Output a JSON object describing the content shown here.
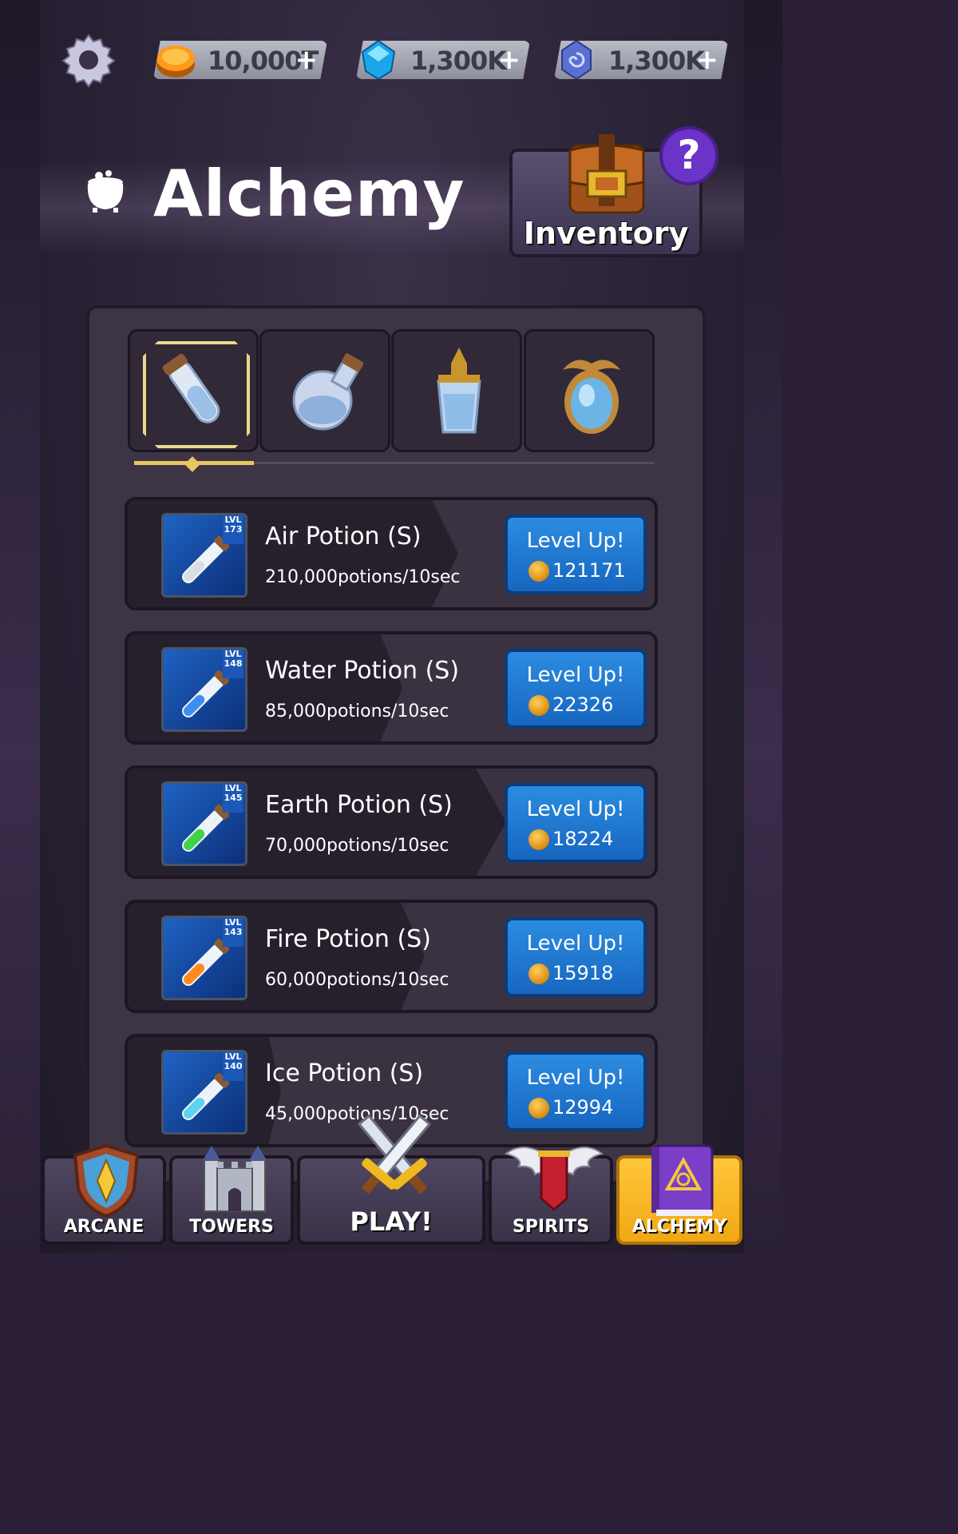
{
  "topbar": {
    "settings_icon": "gear-icon",
    "currencies": [
      {
        "name": "gold",
        "icon": "gold-coin-icon",
        "value": "10,000T",
        "plus": "+"
      },
      {
        "name": "gems",
        "icon": "blue-gem-icon",
        "value": "1,300K",
        "plus": "+"
      },
      {
        "name": "mana",
        "icon": "spiral-crystal-icon",
        "value": "1,300K",
        "plus": "+"
      }
    ]
  },
  "header": {
    "title": "Alchemy",
    "title_icon": "cauldron-icon",
    "inventory_label": "Inventory",
    "help_label": "?"
  },
  "tabs": [
    {
      "icon": "test-tube-potion-icon",
      "selected": true
    },
    {
      "icon": "round-flask-potion-icon",
      "selected": false
    },
    {
      "icon": "crystal-bottle-potion-icon",
      "selected": false
    },
    {
      "icon": "ornate-orb-potion-icon",
      "selected": false
    }
  ],
  "potions": [
    {
      "name": "Air Potion (S)",
      "rate": "210,000potions/10sec",
      "lvl_label": "LVL",
      "level": "173",
      "button": "Level Up!",
      "cost": "121171",
      "liquid": "#d8dde6"
    },
    {
      "name": "Water Potion (S)",
      "rate": "85,000potions/10sec",
      "lvl_label": "LVL",
      "level": "148",
      "button": "Level Up!",
      "cost": "22326",
      "liquid": "#3d8ff0"
    },
    {
      "name": "Earth Potion (S)",
      "rate": "70,000potions/10sec",
      "lvl_label": "LVL",
      "level": "145",
      "button": "Level Up!",
      "cost": "18224",
      "liquid": "#3fd34a"
    },
    {
      "name": "Fire Potion (S)",
      "rate": "60,000potions/10sec",
      "lvl_label": "LVL",
      "level": "143",
      "button": "Level Up!",
      "cost": "15918",
      "liquid": "#ff8a1e"
    },
    {
      "name": "Ice Potion (S)",
      "rate": "45,000potions/10sec",
      "lvl_label": "LVL",
      "level": "140",
      "button": "Level Up!",
      "cost": "12994",
      "liquid": "#5fd2f0"
    }
  ],
  "nav": [
    {
      "label": "ARCANE",
      "icon": "shield-icon",
      "active": false
    },
    {
      "label": "TOWERS",
      "icon": "castle-icon",
      "active": false
    },
    {
      "label": "PLAY!",
      "icon": "crossed-swords-icon",
      "active": false
    },
    {
      "label": "SPIRITS",
      "icon": "winged-banner-icon",
      "active": false
    },
    {
      "label": "ALCHEMY",
      "icon": "spellbook-icon",
      "active": true
    }
  ],
  "colors": {
    "accent_gold": "#e8c65e",
    "button_blue": "#2c8ce0",
    "active_tab": "#ffc63a",
    "help_purple": "#6b33c8"
  }
}
